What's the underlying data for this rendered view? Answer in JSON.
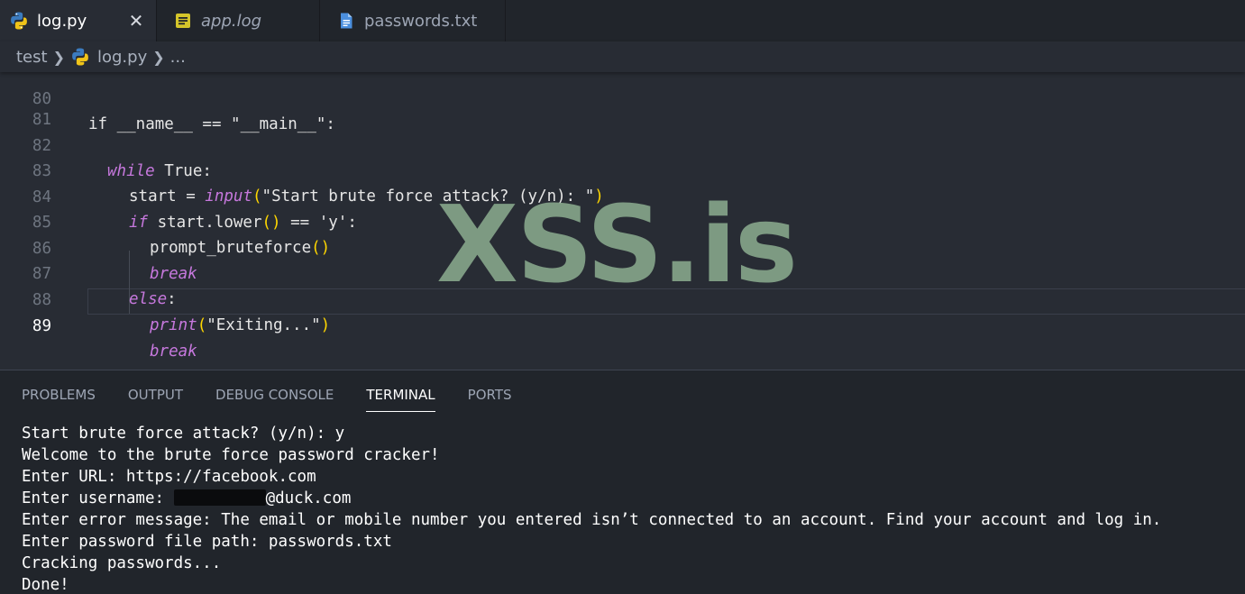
{
  "tabs": [
    {
      "label": "log.py",
      "icon": "python-icon",
      "active": true,
      "close": "✕"
    },
    {
      "label": "app.log",
      "icon": "log-file-icon",
      "active": false
    },
    {
      "label": "passwords.txt",
      "icon": "text-file-icon",
      "active": false
    }
  ],
  "breadcrumb": {
    "folder": "test",
    "file": "log.py",
    "more": "..."
  },
  "editor": {
    "lines": [
      {
        "num": "80",
        "text": "if __name__ == \"__main__\":"
      },
      {
        "num": "81",
        "text": ""
      },
      {
        "num": "82",
        "kw": "while",
        "rest": " True:"
      },
      {
        "num": "83",
        "pre": "start = ",
        "fn": "input",
        "open": "(",
        "str": "\"Start brute force attack? (y/n): \"",
        "close": ")"
      },
      {
        "num": "84",
        "kw": "if",
        "rest": " start.lower",
        "open": "()",
        "tail": " == 'y':"
      },
      {
        "num": "85",
        "pre": "prompt_bruteforce",
        "open": "()"
      },
      {
        "num": "86",
        "kw": "break"
      },
      {
        "num": "87",
        "kw": "else",
        "rest": ":"
      },
      {
        "num": "88",
        "fn": "print",
        "open": "(",
        "str": "\"Exiting...\"",
        "close": ")"
      },
      {
        "num": "89",
        "kw": "break"
      }
    ]
  },
  "watermark": "XSS.is",
  "panel": {
    "tabs": [
      "PROBLEMS",
      "OUTPUT",
      "DEBUG CONSOLE",
      "TERMINAL",
      "PORTS"
    ],
    "active_tab": "TERMINAL"
  },
  "terminal": {
    "lines": [
      "Start brute force attack? (y/n): y",
      "Welcome to the brute force password cracker!",
      "Enter URL: https://facebook.com",
      "Enter username: ",
      "Enter error message: The email or mobile number you entered isn’t connected to an account. Find your account and log in.",
      "Enter password file path: passwords.txt",
      "Cracking passwords...",
      "Done!"
    ],
    "username_suffix": "@duck.com"
  },
  "colors": {
    "keyword": "#c678dd",
    "bracket": "#ffd700",
    "editor_bg": "#282c34",
    "panel_bg": "#21252b",
    "watermark": "#90b294"
  }
}
